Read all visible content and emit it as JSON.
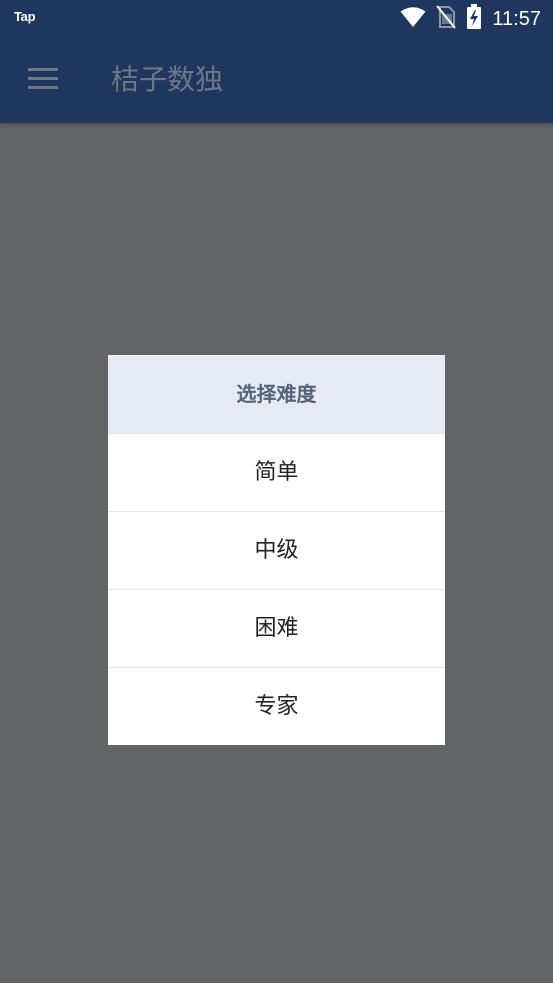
{
  "status_bar": {
    "carrier_label": "Tap",
    "time": "11:57",
    "icons": [
      "wifi-icon",
      "no-sim-icon",
      "battery-charging-icon"
    ]
  },
  "app_bar": {
    "menu_icon": "hamburger-menu-icon",
    "title": "桔子数独"
  },
  "dialog": {
    "title": "选择难度",
    "options": [
      {
        "label": "简单"
      },
      {
        "label": "中级"
      },
      {
        "label": "困难"
      },
      {
        "label": "专家"
      }
    ]
  },
  "colors": {
    "app_bar": "#1f365f",
    "scrim": "#636466",
    "dialog_header": "#e6eaf3",
    "dialog_header_text": "#56627a",
    "app_bar_text": "#6e7786"
  }
}
